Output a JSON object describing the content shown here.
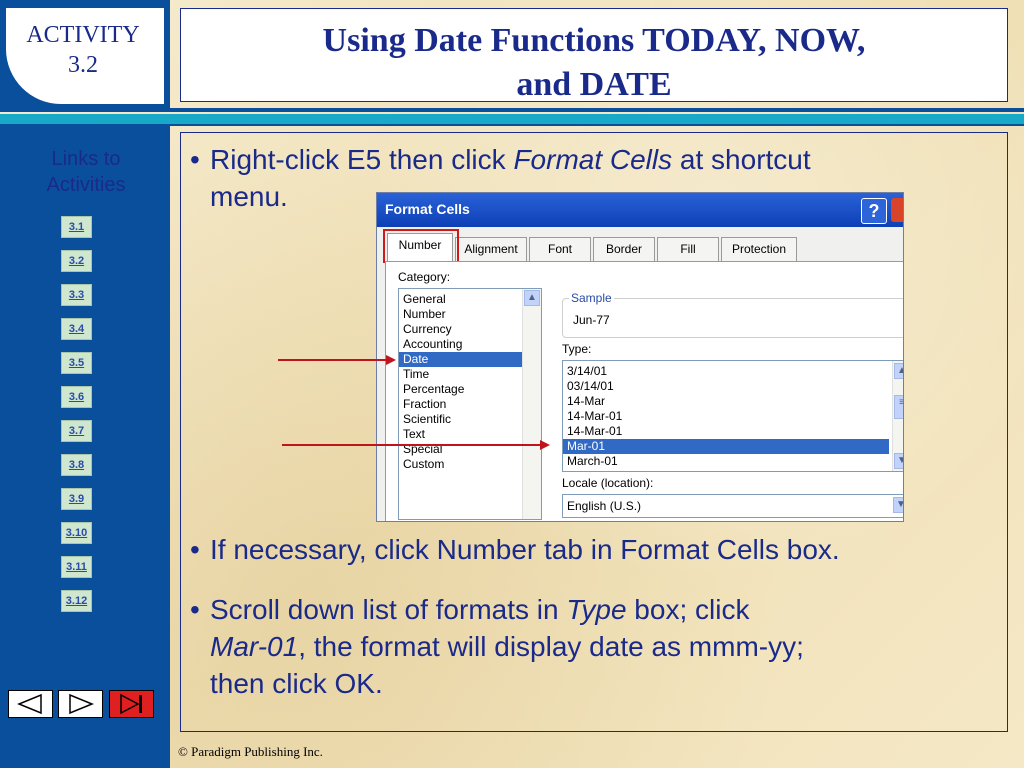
{
  "header": {
    "activity_line1": "ACTIVITY",
    "activity_line2": "3.2",
    "title_line1": "Using Date Functions TODAY, NOW,",
    "title_line2": "and DATE"
  },
  "sidebar": {
    "links_title_line1": "Links to",
    "links_title_line2": "Activities",
    "links": [
      "3.1",
      "3.2",
      "3.3",
      "3.4",
      "3.5",
      "3.6",
      "3.7",
      "3.8",
      "3.9",
      "3.10",
      "3.11",
      "3.12"
    ]
  },
  "content": {
    "bullet_marker": "•",
    "bullet1_a": "Right-click E5 then click ",
    "bullet1_em": "Format Cells",
    "bullet1_b": " at shortcut",
    "bullet1_line2": "menu.",
    "bullet2": "If necessary, click Number tab in Format Cells box.",
    "bullet3_a": "Scroll down list of formats in ",
    "bullet3_em": "Type",
    "bullet3_b": " box; click",
    "bullet3_em2": "Mar-01",
    "bullet3_c": ", the format will display date as mmm-yy;",
    "bullet3_line3": "then click OK."
  },
  "dialog": {
    "title": "Format Cells",
    "help": "?",
    "tabs": [
      "Number",
      "Alignment",
      "Font",
      "Border",
      "Fill",
      "Protection"
    ],
    "category_label": "Category:",
    "categories": [
      "General",
      "Number",
      "Currency",
      "Accounting",
      "Date",
      "Time",
      "Percentage",
      "Fraction",
      "Scientific",
      "Text",
      "Special",
      "Custom"
    ],
    "sample_label": "Sample",
    "sample_value": "Jun-77",
    "type_label": "Type:",
    "types": [
      "3/14/01",
      "03/14/01",
      "14-Mar",
      "14-Mar-01",
      "14-Mar-01",
      "Mar-01",
      "March-01"
    ],
    "locale_label": "Locale (location):",
    "locale_value": "English (U.S.)"
  },
  "footer": {
    "text": "© Paradigm Publishing Inc."
  },
  "colors": {
    "navy": "#1a2a8a",
    "blue_bar": "#0a4f9c",
    "accent_red": "#c0141d"
  }
}
